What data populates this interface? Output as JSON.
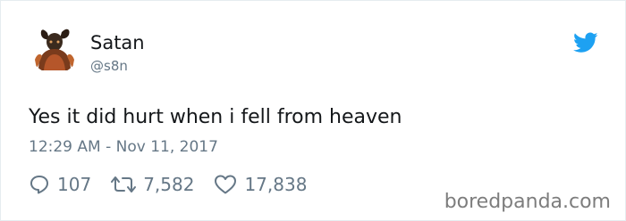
{
  "tweet": {
    "display_name": "Satan",
    "handle": "@s8n",
    "text": "Yes it did hurt when i fell from heaven",
    "timestamp": "12:29 AM - Nov 11, 2017",
    "avatar_icon": "devil-avatar",
    "platform_icon": "twitter-bird-icon",
    "brand_color": "#1da1f2",
    "actions": {
      "replies": "107",
      "retweets": "7,582",
      "likes": "17,838"
    }
  },
  "watermark": "boredpanda.com",
  "colors": {
    "text_primary": "#14171a",
    "text_secondary": "#657786",
    "watermark": "#7d7d7d"
  }
}
